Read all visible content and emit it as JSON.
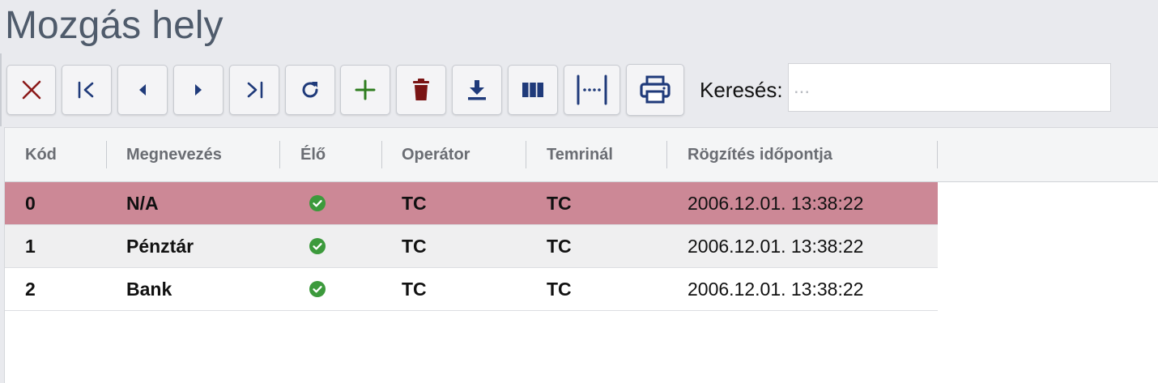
{
  "page": {
    "title": "Mozgás hely"
  },
  "toolbar": {
    "buttons": [
      {
        "name": "close-button",
        "icon": "close-icon",
        "color": "#8b1a1a"
      },
      {
        "name": "first-record-button",
        "icon": "first-icon",
        "color": "#1f3a7a"
      },
      {
        "name": "previous-record-button",
        "icon": "caret-left-icon",
        "color": "#1f3a7a"
      },
      {
        "name": "next-record-button",
        "icon": "caret-right-icon",
        "color": "#1f3a7a"
      },
      {
        "name": "last-record-button",
        "icon": "last-icon",
        "color": "#1f3a7a"
      },
      {
        "name": "refresh-button",
        "icon": "refresh-icon",
        "color": "#1f3a7a"
      },
      {
        "name": "add-button",
        "icon": "plus-icon",
        "color": "#2e7d1f"
      },
      {
        "name": "delete-button",
        "icon": "trash-icon",
        "color": "#7a1414"
      },
      {
        "name": "download-button",
        "icon": "download-icon",
        "color": "#1f3a7a"
      },
      {
        "name": "columns-button",
        "icon": "columns-icon",
        "color": "#1f3a7a"
      },
      {
        "name": "fit-columns-button",
        "icon": "fit-width-icon",
        "color": "#1f3a7a"
      },
      {
        "name": "print-button",
        "icon": "print-icon",
        "color": "#1f3a7a"
      }
    ],
    "search": {
      "label": "Keresés:",
      "placeholder": "...",
      "value": ""
    }
  },
  "grid": {
    "columns": [
      "Kód",
      "Megnevezés",
      "Élő",
      "Operátor",
      "Temrinál",
      "Rögzítés időpontja"
    ],
    "rows": [
      {
        "kod": "0",
        "megnevezes": "N/A",
        "elo": true,
        "operator": "TC",
        "terminal": "TC",
        "rogzites": "2006.12.01. 13:38:22",
        "selected": true
      },
      {
        "kod": "1",
        "megnevezes": "Pénztár",
        "elo": true,
        "operator": "TC",
        "terminal": "TC",
        "rogzites": "2006.12.01. 13:38:22",
        "selected": false
      },
      {
        "kod": "2",
        "megnevezes": "Bank",
        "elo": true,
        "operator": "TC",
        "terminal": "TC",
        "rogzites": "2006.12.01. 13:38:22",
        "selected": false
      }
    ],
    "colors": {
      "selected_row": "#cc8896",
      "alt_row": "#efeff0",
      "row": "#ffffff",
      "check": "#3c9a3c"
    }
  }
}
